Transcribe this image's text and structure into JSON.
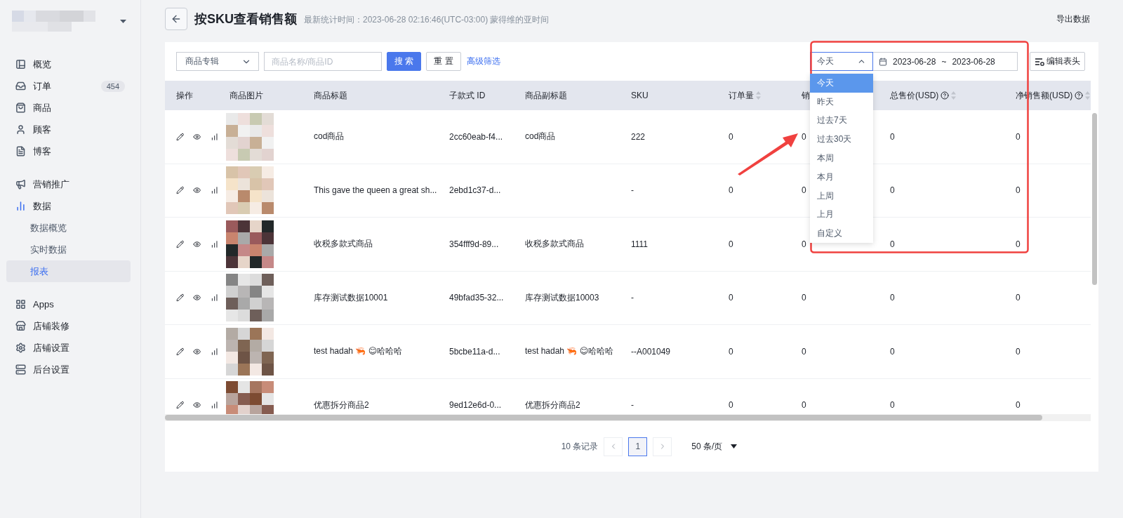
{
  "sidebar": {
    "groups": [
      {
        "items": [
          {
            "label": "概览",
            "selected": false
          },
          {
            "label": "订单",
            "badge": "454",
            "selected": false
          },
          {
            "label": "商品",
            "selected": false
          },
          {
            "label": "顾客",
            "selected": false
          },
          {
            "label": "博客",
            "selected": false
          }
        ]
      },
      {
        "items": [
          {
            "label": "营销推广",
            "selected": false
          },
          {
            "label": "数据",
            "selected": false,
            "children": [
              {
                "label": "数据概览",
                "selected": false
              },
              {
                "label": "实时数据",
                "selected": false
              },
              {
                "label": "报表",
                "selected": true
              }
            ]
          }
        ]
      },
      {
        "items": [
          {
            "label": "Apps",
            "selected": false
          },
          {
            "label": "店铺装修",
            "selected": false
          },
          {
            "label": "店铺设置",
            "selected": false
          },
          {
            "label": "后台设置",
            "selected": false
          }
        ]
      }
    ]
  },
  "header": {
    "title": "按SKU查看销售额",
    "subtitle": "最新统计时间：2023-06-28 02:16:46(UTC-03:00) 蒙得维的亚时间",
    "export": "导出数据"
  },
  "filters": {
    "category": "商品专辑",
    "search_placeholder": "商品名称/商品ID",
    "search": "搜 索",
    "reset": "重 置",
    "advanced": "高级筛选",
    "range": {
      "value": "今天",
      "expanded": true,
      "options": [
        {
          "label": "今天",
          "selected": true
        },
        {
          "label": "昨天",
          "selected": false
        },
        {
          "label": "过去7天",
          "selected": false
        },
        {
          "label": "过去30天",
          "selected": false
        },
        {
          "label": "本周",
          "selected": false
        },
        {
          "label": "本月",
          "selected": false
        },
        {
          "label": "上周",
          "selected": false
        },
        {
          "label": "上月",
          "selected": false
        },
        {
          "label": "自定义",
          "selected": false
        }
      ]
    },
    "date_from": "2023-06-28",
    "date_sep": "~",
    "date_to": "2023-06-28",
    "edit_columns": "编辑表头"
  },
  "table": {
    "columns": [
      {
        "label": "操作",
        "sortable": false,
        "help": false
      },
      {
        "label": "商品图片",
        "sortable": false,
        "help": false
      },
      {
        "label": "商品标题",
        "sortable": false,
        "help": false
      },
      {
        "label": "子款式 ID",
        "sortable": false,
        "help": false
      },
      {
        "label": "商品副标题",
        "sortable": false,
        "help": false
      },
      {
        "label": "SKU",
        "sortable": false,
        "help": false
      },
      {
        "label": "订单量",
        "sortable": true,
        "help": false
      },
      {
        "label": "销",
        "sortable": false,
        "help": false
      },
      {
        "label": "总售价(USD)",
        "sortable": true,
        "help": true
      },
      {
        "label": "净销售额(USD)",
        "sortable": true,
        "help": true
      }
    ],
    "rows": [
      {
        "title": "cod商品",
        "variant_id": "2cc60eab-f4...",
        "subtitle": "cod商品",
        "sku": "222",
        "orders": "0",
        "column_8": "0",
        "total": "0",
        "net": "0"
      },
      {
        "title": "This gave the queen a great sh...",
        "variant_id": "2ebd1c37-d...",
        "subtitle": "",
        "sku": "-",
        "orders": "0",
        "column_8": "0",
        "total": "0",
        "net": "0"
      },
      {
        "title": "收税多款式商品",
        "variant_id": "354fff9d-89...",
        "subtitle": "收税多款式商品",
        "sku": "1111",
        "orders": "0",
        "column_8": "0",
        "total": "0",
        "net": "0"
      },
      {
        "title": "库存测试数据10001",
        "variant_id": "49bfad35-32...",
        "subtitle": "库存测试数据10003",
        "sku": "-",
        "orders": "0",
        "column_8": "0",
        "total": "0",
        "net": "0"
      },
      {
        "title": "test hadah 🦐 😊哈哈哈",
        "variant_id": "5bcbe11a-d...",
        "subtitle": "test hadah 🦐 😊哈哈哈",
        "sku": "--A001049",
        "orders": "0",
        "column_8": "0",
        "total": "0",
        "net": "0"
      },
      {
        "title": "优惠拆分商品2",
        "variant_id": "9ed12e6d-0...",
        "subtitle": "优惠拆分商品2",
        "sku": "-",
        "orders": "0",
        "column_8": "0",
        "total": "0",
        "net": "0"
      }
    ]
  },
  "pagination": {
    "total": "10 条记录",
    "pages": [
      {
        "label": "1",
        "selected": true
      }
    ],
    "page_size": "50 条/页"
  }
}
